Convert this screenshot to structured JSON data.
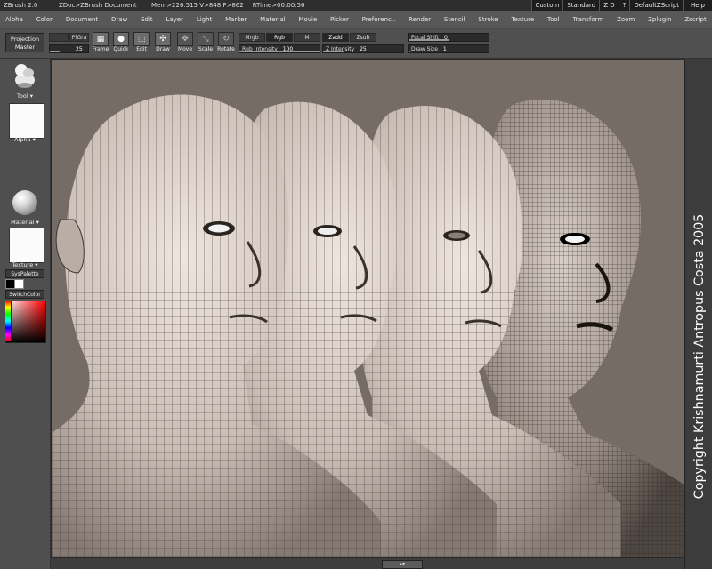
{
  "titlebar": {
    "app": "ZBrush 2.0",
    "document": "ZDoc>ZBrush Document",
    "stats": "Mem>226.515  V>848  F>862",
    "rtime": "RTime>00:00:56",
    "custom": "Custom",
    "standard": "Standard",
    "zd": "Z D",
    "help_q": "?",
    "default_script": "DefaultZScript",
    "help": "Help"
  },
  "menu": [
    "Alpha",
    "Color",
    "Document",
    "Draw",
    "Edit",
    "Layer",
    "Light",
    "Marker",
    "Material",
    "Movie",
    "Picker",
    "Preferenc..",
    "Render",
    "Stencil",
    "Stroke",
    "Texture",
    "Tool",
    "Transform",
    "Zoom",
    "Zplugin",
    "Zscript"
  ],
  "toolbar": {
    "projection_master_1": "Projection",
    "projection_master_2": "Master",
    "pfgra": "PfGra",
    "small_box_val": "25",
    "frame": "Frame",
    "quick": "Quick",
    "edit": "Edit",
    "draw": "Draw",
    "move": "Move",
    "scale": "Scale",
    "rotate": "Rotate",
    "mrgb": "Mrgb",
    "rgb": "Rgb",
    "m": "M",
    "rgb_intensity_label": "Rgb Intensity",
    "rgb_intensity": "100",
    "zadd": "Zadd",
    "zsub": "Zsub",
    "z_intensity_label": "Z Intensity",
    "z_intensity": "25",
    "focal_shift_label": "Focal Shift",
    "focal_shift": "0",
    "draw_size_label": "Draw Size",
    "draw_size": "1"
  },
  "left_tray": {
    "tool": "Tool",
    "alpha": "Alpha",
    "material": "Material",
    "texture": "Texture",
    "syspalette": "SysPalette",
    "switchcolor": "SwitchColor"
  },
  "canvas": {
    "copyright": "Copyright Krishnamurti Antropus Costa 2005"
  },
  "colors": {
    "canvas_bg": "#766c66",
    "ui_bg": "#4b4b4b",
    "mesh_skin": "#c9bdb5"
  }
}
